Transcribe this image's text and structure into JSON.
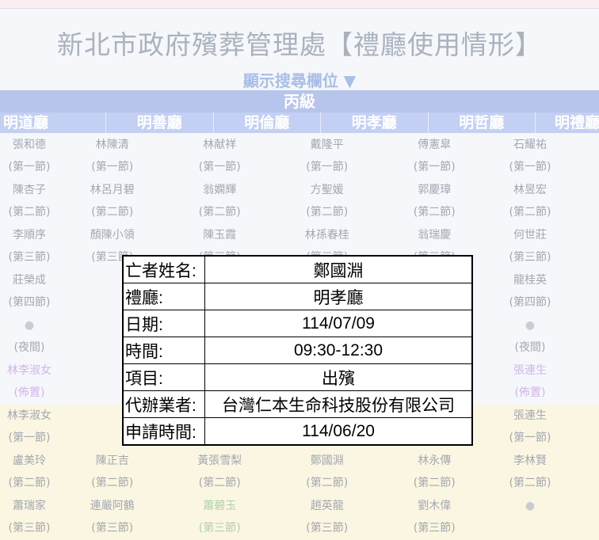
{
  "header": {
    "title": "新北市政府殯葬管理處【禮廳使用情形】",
    "toggle_label": "顯示搜尋欄位 ▼",
    "grade_label": "丙級"
  },
  "halls": [
    "明道廳",
    "明善廳",
    "明倫廳",
    "明孝廳",
    "明哲廳",
    "明禮廳"
  ],
  "rows": [
    {
      "bg": "white",
      "cells": [
        {
          "name": "張和德",
          "slot": "(第一節)"
        },
        {
          "name": "林陳清",
          "slot": "(第一節)"
        },
        {
          "name": "林献祥",
          "slot": "(第一節)"
        },
        {
          "name": "戴隆平",
          "slot": "(第一節)"
        },
        {
          "name": "傅憲皐",
          "slot": "(第一節)"
        },
        {
          "name": "石耀祐",
          "slot": "(第一節)"
        }
      ]
    },
    {
      "bg": "white",
      "cells": [
        {
          "name": "陳杏子",
          "slot": "(第二節)"
        },
        {
          "name": "林呂月碧",
          "slot": "(第二節)"
        },
        {
          "name": "翁嫻輝",
          "slot": "(第二節)"
        },
        {
          "name": "方聖媛",
          "slot": "(第二節)"
        },
        {
          "name": "郭慶璋",
          "slot": "(第二節)"
        },
        {
          "name": "林昱宏",
          "slot": "(第二節)"
        }
      ]
    },
    {
      "bg": "white",
      "cells": [
        {
          "name": "李順序",
          "slot": "(第三節)"
        },
        {
          "name": "顏陳小領",
          "slot": "(第三節)"
        },
        {
          "name": "陳玉霞",
          "slot": "(第三節)"
        },
        {
          "name": "林孫春桂",
          "slot": "(第三節)"
        },
        {
          "name": "翁瑞慶",
          "slot": "(第三節)"
        },
        {
          "name": "何世莊",
          "slot": "(第三節)"
        }
      ]
    },
    {
      "bg": "white",
      "cells": [
        {
          "name": "莊榮成",
          "slot": "(第四節)"
        },
        {
          "name": "",
          "slot": ""
        },
        {
          "name": "",
          "slot": ""
        },
        {
          "name": "",
          "slot": ""
        },
        {
          "name": "",
          "slot": ""
        },
        {
          "name": "龍桂英",
          "slot": "(第四節)"
        }
      ]
    },
    {
      "bg": "white",
      "cells": [
        {
          "name": "●",
          "slot": "(夜間)",
          "dot": true
        },
        {
          "name": "",
          "slot": ""
        },
        {
          "name": "",
          "slot": ""
        },
        {
          "name": "",
          "slot": ""
        },
        {
          "name": "",
          "slot": ""
        },
        {
          "name": "●",
          "slot": "(夜間)",
          "dot": true
        }
      ]
    },
    {
      "bg": "white",
      "cells": [
        {
          "name": "林李淑女",
          "slot": "(佈置)",
          "purple": true
        },
        {
          "name": "",
          "slot": ""
        },
        {
          "name": "",
          "slot": ""
        },
        {
          "name": "",
          "slot": ""
        },
        {
          "name": "",
          "slot": ""
        },
        {
          "name": "張連生",
          "slot": "(佈置)",
          "purple": true
        }
      ]
    },
    {
      "bg": "yellow",
      "cells": [
        {
          "name": "林李淑女",
          "slot": "(第一節)"
        },
        {
          "name": "",
          "slot": ""
        },
        {
          "name": "",
          "slot": ""
        },
        {
          "name": "",
          "slot": ""
        },
        {
          "name": "",
          "slot": ""
        },
        {
          "name": "張連生",
          "slot": "(第一節)"
        }
      ]
    },
    {
      "bg": "yellow",
      "cells": [
        {
          "name": "盧美玲",
          "slot": "(第二節)"
        },
        {
          "name": "陳正吉",
          "slot": "(第二節)"
        },
        {
          "name": "黃張雪梨",
          "slot": "(第二節)"
        },
        {
          "name": "鄭國淵",
          "slot": "(第二節)"
        },
        {
          "name": "林永傳",
          "slot": "(第二節)"
        },
        {
          "name": "李林賢",
          "slot": "(第二節)"
        }
      ]
    },
    {
      "bg": "yellow",
      "cells": [
        {
          "name": "蕭瑞家",
          "slot": "(第三節)"
        },
        {
          "name": "連嚴阿鶴",
          "slot": "(第三節)"
        },
        {
          "name": "蕭碧玉",
          "slot": "(第三節)",
          "green": true
        },
        {
          "name": "趙英龍",
          "slot": "(第三節)"
        },
        {
          "name": "劉木偉",
          "slot": "(第三節)"
        },
        {
          "name": "●",
          "slot": "",
          "dot": true
        }
      ]
    }
  ],
  "popup": {
    "rows": [
      {
        "label": "亡者姓名:",
        "value": "鄭國淵"
      },
      {
        "label": "禮廳:",
        "value": "明孝廳"
      },
      {
        "label": "日期:",
        "value": "114/07/09"
      },
      {
        "label": "時間:",
        "value": "09:30-12:30"
      },
      {
        "label": "項目:",
        "value": "出殯"
      },
      {
        "label": "代辦業者:",
        "value": "台灣仁本生命科技股份有限公司"
      },
      {
        "label": "申請時間:",
        "value": "114/06/20"
      }
    ]
  }
}
